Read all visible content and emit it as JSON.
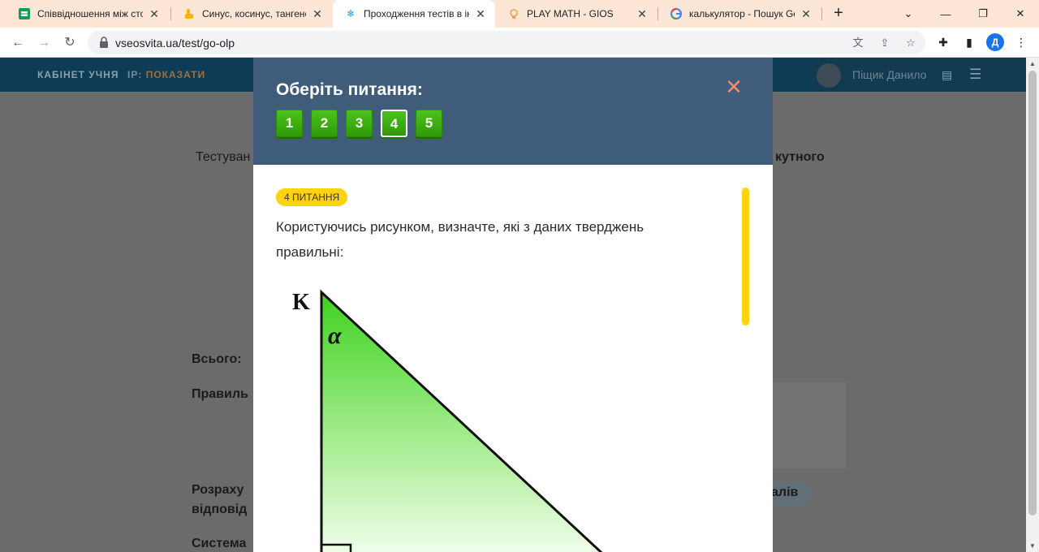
{
  "browser": {
    "tabs": [
      {
        "title": "Співвідношення між сто",
        "icon": "sheets-icon",
        "active": false
      },
      {
        "title": "Синус, косинус, тангенс",
        "icon": "hand-icon",
        "active": false
      },
      {
        "title": "Проходження тестів в ін",
        "icon": "snowflake-icon",
        "active": true
      },
      {
        "title": "PLAY MATH - GIOS",
        "icon": "bulb-icon",
        "active": false
      },
      {
        "title": "калькулятор - Пошук Go",
        "icon": "google-icon",
        "active": false
      }
    ],
    "new_tab": "+",
    "url": "vseosvita.ua/test/go-olp",
    "profile_initial": "Д"
  },
  "site": {
    "cabinet": "КАБІНЕТ УЧНЯ",
    "ip_label": "IP:",
    "ip_action": "ПОКАЗАТИ",
    "user_name": "Піщик Данило"
  },
  "background": {
    "test_prefix": "Тестуван",
    "test_suffix": "кутного",
    "total": "Всього:",
    "correct": "Правиль",
    "calc1": "Розраху",
    "calc2": "відповід",
    "pill_text": "алів",
    "system": "Система"
  },
  "modal": {
    "title": "Оберіть питання:",
    "close": "✕",
    "questions": [
      "1",
      "2",
      "3",
      "4",
      "5"
    ],
    "current_question": "4",
    "badge": "4 ПИТАННЯ",
    "question_text": "Користуючись рисунком, визначте, які з даних тверджень правильні:",
    "figure": {
      "vertex_label": "K",
      "angle_label": "α"
    }
  },
  "colors": {
    "modal_header": "#3f5d7a",
    "question_button": "#3aae13",
    "badge": "#ffd40f",
    "close": "#f38a6d"
  }
}
